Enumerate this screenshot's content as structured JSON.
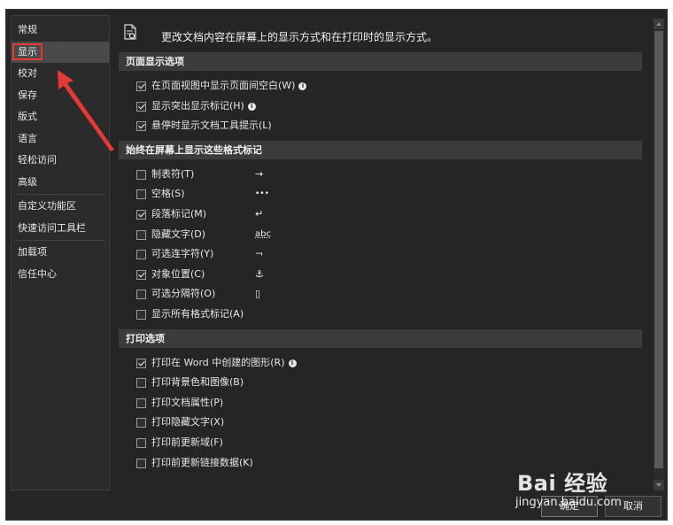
{
  "sidebar": {
    "items": [
      {
        "label": "常规"
      },
      {
        "label": "显示"
      },
      {
        "label": "校对"
      },
      {
        "label": "保存"
      },
      {
        "label": "版式"
      },
      {
        "label": "语言"
      },
      {
        "label": "轻松访问"
      },
      {
        "label": "高级"
      },
      {
        "label": "自定义功能区"
      },
      {
        "label": "快速访问工具栏"
      },
      {
        "label": "加载项"
      },
      {
        "label": "信任中心"
      }
    ],
    "selected": "显示"
  },
  "header": {
    "description": "更改文档内容在屏幕上的显示方式和在打印时的显示方式。",
    "icon": "document-display-icon"
  },
  "page_display": {
    "title": "页面显示选项",
    "options": [
      {
        "label": "在页面视图中显示页面间空白(W)",
        "checked": true,
        "info": true
      },
      {
        "label": "显示突出显示标记(H)",
        "checked": true,
        "info": true
      },
      {
        "label": "悬停时显示文档工具提示(L)",
        "checked": true,
        "info": false
      }
    ]
  },
  "format_marks": {
    "title": "始终在屏幕上显示这些格式标记",
    "options": [
      {
        "label": "制表符(T)",
        "checked": false,
        "symbol": "→"
      },
      {
        "label": "空格(S)",
        "checked": false,
        "symbol": "•••"
      },
      {
        "label": "段落标记(M)",
        "checked": true,
        "symbol": "↵"
      },
      {
        "label": "隐藏文字(D)",
        "checked": false,
        "symbol": "abc"
      },
      {
        "label": "可选连字符(Y)",
        "checked": false,
        "symbol": "¬"
      },
      {
        "label": "对象位置(C)",
        "checked": true,
        "symbol": "⚓"
      },
      {
        "label": "可选分隔符(O)",
        "checked": false,
        "symbol": "▯"
      },
      {
        "label": "显示所有格式标记(A)",
        "checked": false,
        "symbol": ""
      }
    ]
  },
  "print": {
    "title": "打印选项",
    "options": [
      {
        "label": "打印在 Word 中创建的图形(R)",
        "checked": true,
        "info": true
      },
      {
        "label": "打印背景色和图像(B)",
        "checked": false,
        "info": false
      },
      {
        "label": "打印文档属性(P)",
        "checked": false,
        "info": false
      },
      {
        "label": "打印隐藏文字(X)",
        "checked": false,
        "info": false
      },
      {
        "label": "打印前更新域(F)",
        "checked": false,
        "info": false
      },
      {
        "label": "打印前更新链接数据(K)",
        "checked": false,
        "info": false
      }
    ]
  },
  "buttons": {
    "ok": "确定",
    "cancel": "取消"
  },
  "watermark": {
    "brand": "Bai 经验",
    "url": "jingyan.baidu.com"
  },
  "colors": {
    "background": "#252525",
    "section_bar": "#3b3b3b",
    "highlight": "#e53935"
  }
}
